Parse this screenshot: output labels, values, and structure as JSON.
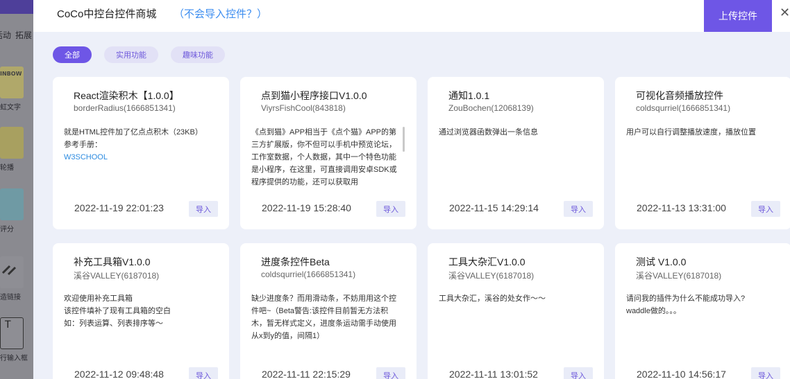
{
  "background": {
    "tabs": [
      "活动",
      "拓展"
    ],
    "items": [
      {
        "label": "虹文字",
        "thumb_text": "INBOW"
      },
      {
        "label": "轮播"
      },
      {
        "label": "评分"
      },
      {
        "label": "造链接"
      },
      {
        "label": "行输入框"
      }
    ]
  },
  "modal": {
    "title": "CoCo中控台控件商城",
    "help_link": "（不会导入控件？）",
    "upload_label": "上传控件",
    "close_symbol": "✕",
    "filters": [
      {
        "label": "全部",
        "active": true
      },
      {
        "label": "实用功能",
        "active": false
      },
      {
        "label": "趣味功能",
        "active": false
      }
    ],
    "import_label": "导入",
    "cards": [
      {
        "title": "React渲染积木【1.0.0】",
        "author": "borderRadius(1666851341)",
        "desc": "就是HTML控件加了亿点点积木（23KB）\n参考手册：",
        "link": "W3SCHOOL",
        "date": "2022-11-19 22:01:23"
      },
      {
        "title": "点到猫小程序接口V1.0.0",
        "author": "ViyrsFishCool(843818)",
        "desc": "《点到猫》APP相当于《点个猫》APP的第三方扩展版，你不但可以手机中预览论坛，工作室数据，个人数据，其中一个特色功能是小程序，在这里，可直接调用安卓SDK或程序提供的功能，还可以获取用",
        "date": "2022-11-19 15:28:40"
      },
      {
        "title": "通知1.0.1",
        "author": "ZouBochen(12068139)",
        "desc": "通过浏览器函数弹出一条信息",
        "date": "2022-11-15 14:29:14"
      },
      {
        "title": "可视化音频播放控件",
        "author": "coldsqurriel(1666851341)",
        "desc": "用户可以自行调整播放速度，播放位置",
        "date": "2022-11-13 13:31:00"
      },
      {
        "title": "补充工具箱V1.0.0",
        "author": "溪谷VALLEY(6187018)",
        "desc": "欢迎使用补充工具箱\n该控件填补了现有工具箱的空白\n如：列表运算、列表排序等〜",
        "date": "2022-11-12 09:48:48"
      },
      {
        "title": "进度条控件Beta",
        "author": "coldsqurriel(1666851341)",
        "desc": "缺少进度条？而用滑动条，不妨用用这个控件吧~（Beta警告:该控件目前暂无方法积木，暂无样式定义，进度条运动需手动使用从x到y的值，间隔1）",
        "date": "2022-11-11 22:15:29"
      },
      {
        "title": "工具大杂汇V1.0.0",
        "author": "溪谷VALLEY(6187018)",
        "desc": "工具大杂汇，溪谷的处女作〜〜",
        "date": "2022-11-11 13:01:52"
      },
      {
        "title": "测试 V1.0.0",
        "author": "溪谷VALLEY(6187018)",
        "desc": "请问我的插件为什么不能成功导入?\nwaddle做的。。。",
        "date": "2022-11-10 14:56:17"
      }
    ]
  },
  "colors": {
    "accent": "#6e56e6",
    "link": "#3c8df0",
    "modal_bg": "#edf0f9"
  }
}
